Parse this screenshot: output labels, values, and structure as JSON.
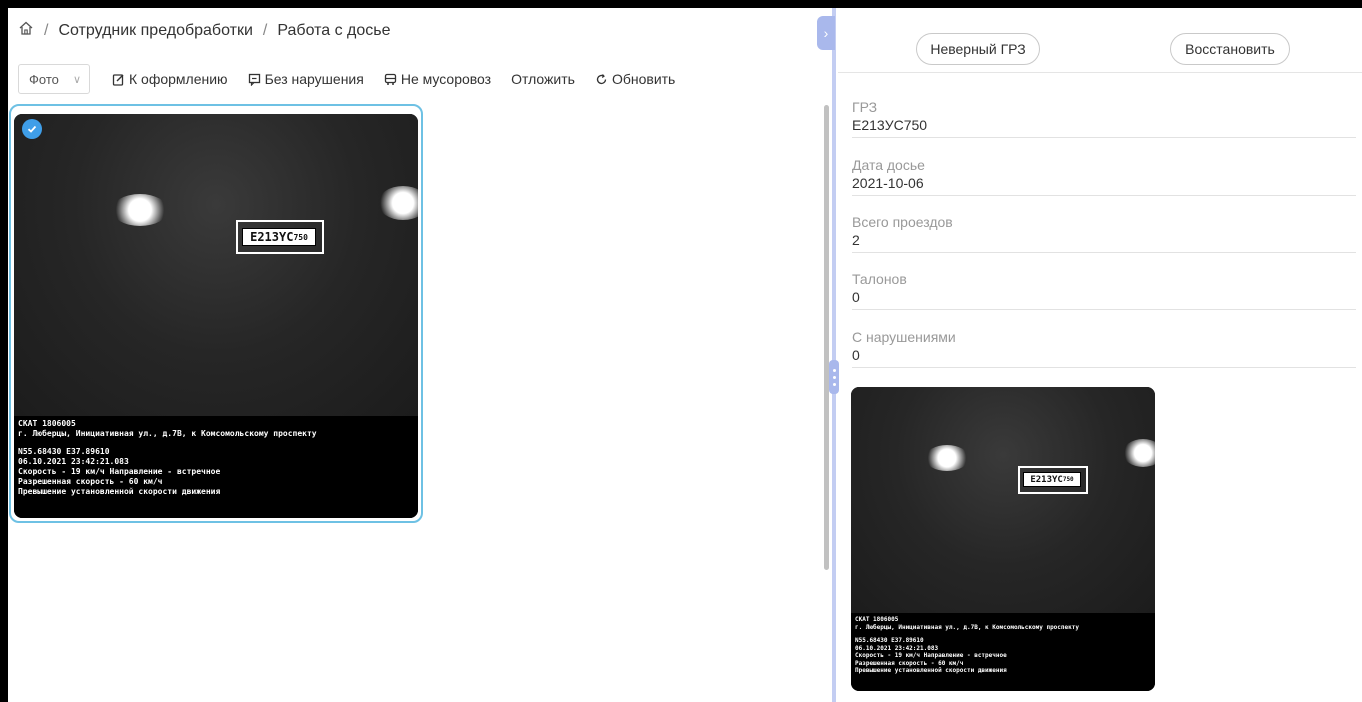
{
  "breadcrumb": {
    "items": [
      "Сотрудник предобработки",
      "Работа с досье"
    ],
    "separator": "/"
  },
  "toolbar": {
    "photo_select": "Фото",
    "to_design": "К оформлению",
    "no_violation": "Без нарушения",
    "not_garbage_truck": "Не мусоровоз",
    "postpone": "Отложить",
    "refresh": "Обновить"
  },
  "photo_card": {
    "selected": true,
    "plate": {
      "main": "E213YC",
      "region": "750"
    },
    "caption": {
      "line1": "СКАТ 1806005",
      "line2": "г. Люберцы, Инициативная ул., д.7В, к Комсомольскому проспекту",
      "line3": "N55.68430 E37.89610",
      "line4": "06.10.2021 23:42:21.083",
      "line5": "Скорость - 19 км/ч Направление - встречное",
      "line6": "Разрешенная скорость - 60 км/ч",
      "line7": "Превышение установленной скорости движения"
    }
  },
  "right_panel": {
    "wrong_plate_button": "Неверный ГРЗ",
    "restore_button": "Восстановить",
    "fields": [
      {
        "label": "ГРЗ",
        "value": "Е213УС750"
      },
      {
        "label": "Дата досье",
        "value": "2021-10-06"
      },
      {
        "label": "Всего проездов",
        "value": "2"
      },
      {
        "label": "Талонов",
        "value": "0"
      },
      {
        "label": "С нарушениями",
        "value": "0"
      }
    ]
  },
  "colors": {
    "selection_border": "#6ec1e4",
    "check_badge": "#3f9ee8",
    "divider": "#c3cdf2",
    "handle": "#a9b8ec"
  }
}
